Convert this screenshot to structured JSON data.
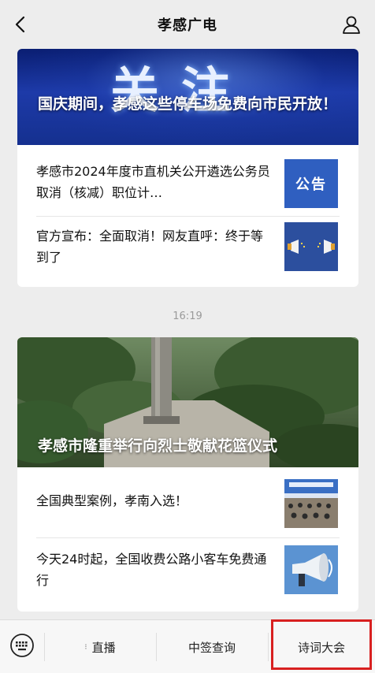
{
  "header": {
    "title": "孝感广电",
    "back_icon": "chevron-left-icon",
    "profile_icon": "person-icon"
  },
  "card1": {
    "hero": {
      "big_text": "关注",
      "caption": "国庆期间，孝感这些停车场免费向市民开放！"
    },
    "items": [
      {
        "text": "孝感市2024年度市直机关公开遴选公务员取消（核减）职位计…",
        "thumb_text": "公告"
      },
      {
        "text": "官方宣布：全面取消！网友直呼：终于等到了",
        "thumb_icon": "megaphone-icon"
      }
    ]
  },
  "timestamp": "16:19",
  "card2": {
    "hero": {
      "caption": "孝感市隆重举行向烈士敬献花篮仪式"
    },
    "items": [
      {
        "text": "全国典型案例，孝南入选！",
        "thumb_icon": "conference-photo"
      },
      {
        "text": "今天24时起，全国收费公路小客车免费通行",
        "thumb_icon": "loudspeaker-icon"
      }
    ]
  },
  "bottom_menu": {
    "keyboard_icon": "keyboard-icon",
    "items": [
      {
        "label": "直播",
        "has_submenu": true
      },
      {
        "label": "中签查询"
      },
      {
        "label": "诗词大会"
      }
    ],
    "highlight_color": "#d82020"
  },
  "colors": {
    "accent_blue": "#2f5fc0",
    "background": "#ededed"
  }
}
